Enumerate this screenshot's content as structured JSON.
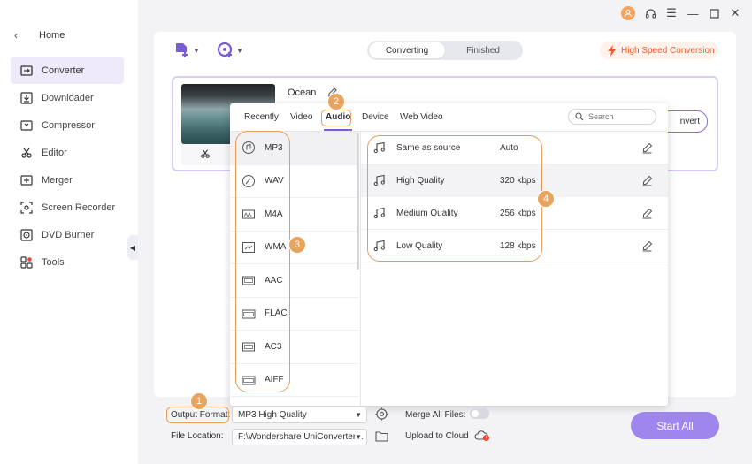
{
  "sidebar": {
    "home_label": "Home",
    "items": [
      {
        "label": "Converter",
        "icon": "converter-icon",
        "active": true
      },
      {
        "label": "Downloader",
        "icon": "downloader-icon"
      },
      {
        "label": "Compressor",
        "icon": "compressor-icon"
      },
      {
        "label": "Editor",
        "icon": "scissors-icon"
      },
      {
        "label": "Merger",
        "icon": "merger-icon"
      },
      {
        "label": "Screen Recorder",
        "icon": "screen-recorder-icon"
      },
      {
        "label": "DVD Burner",
        "icon": "dvd-icon"
      },
      {
        "label": "Tools",
        "icon": "tools-icon"
      }
    ]
  },
  "toolbar": {
    "tabs": [
      "Converting",
      "Finished"
    ],
    "active_tab": "Converting",
    "high_speed_label": "High Speed Conversion"
  },
  "file": {
    "name": "Ocean",
    "convert_label": "nvert"
  },
  "popup": {
    "tabs": [
      "Recently",
      "Video",
      "Audio",
      "Device",
      "Web Video"
    ],
    "active_tab": "Audio",
    "search_placeholder": "Search",
    "formats": [
      "MP3",
      "WAV",
      "M4A",
      "WMA",
      "AAC",
      "FLAC",
      "AC3",
      "AIFF"
    ],
    "selected_format": "MP3",
    "qualities": [
      {
        "name": "Same as source",
        "value": "Auto"
      },
      {
        "name": "High Quality",
        "value": "320 kbps"
      },
      {
        "name": "Medium Quality",
        "value": "256 kbps"
      },
      {
        "name": "Low Quality",
        "value": "128 kbps"
      }
    ]
  },
  "bottom": {
    "output_format_label": "Output Format:",
    "output_format_value": "MP3 High Quality",
    "merge_label": "Merge All Files:",
    "file_location_label": "File Location:",
    "file_location_value": "F:\\Wondershare UniConverter 1",
    "upload_label": "Upload to Cloud",
    "start_all_label": "Start All"
  },
  "callouts": [
    "1",
    "2",
    "3",
    "4"
  ],
  "colors": {
    "accent": "#7a5bd6",
    "start_button": "#9f86ec",
    "callout": "#e8a35e",
    "high_speed": "#f25a2c"
  }
}
